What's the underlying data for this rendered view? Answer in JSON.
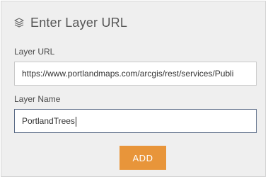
{
  "dialog": {
    "title": "Enter Layer URL",
    "header_icon": "layers-icon",
    "layer_url": {
      "label": "Layer URL",
      "value": "https://www.portlandmaps.com/arcgis/rest/services/Publi"
    },
    "layer_name": {
      "label": "Layer Name",
      "value": "PortlandTrees"
    },
    "add_button_label": "ADD",
    "colors": {
      "panel_background": "#efefef",
      "button": "#e8953a",
      "focused_border": "#5b6c87"
    }
  }
}
